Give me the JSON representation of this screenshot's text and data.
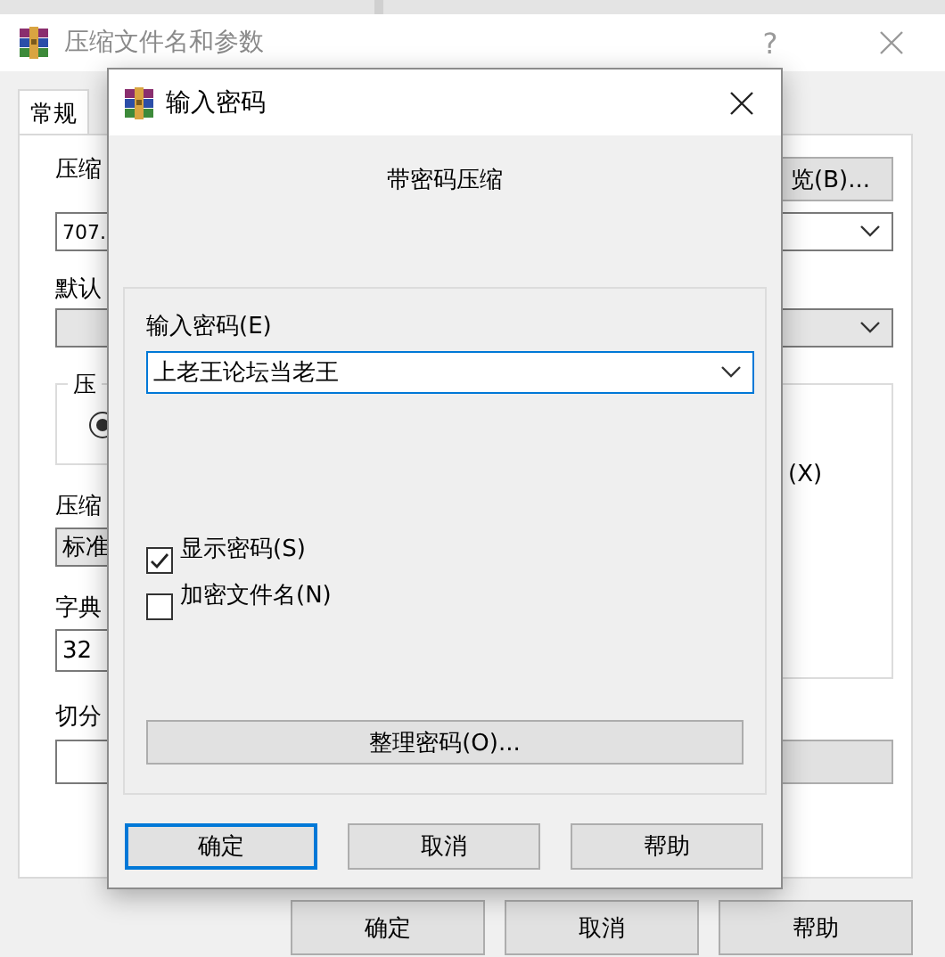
{
  "back_window": {
    "title": "压缩文件名和参数",
    "help_glyph": "?"
  },
  "tabs": [
    {
      "label": "常规",
      "selected": true
    }
  ],
  "general": {
    "archive_label": "压缩",
    "browse_button": "览(B)...",
    "archive_name": "707.",
    "profile_label": "默认",
    "format_label": "压",
    "format_radio_selected": true,
    "method_label": "压缩",
    "method_value": "标准",
    "dict_label": "字典",
    "dict_value": "32",
    "option_fragment": "(X)",
    "split_label": "切分"
  },
  "back_buttons": [
    "确定",
    "取消",
    "帮助"
  ],
  "dialog": {
    "title": "输入密码",
    "heading": "带密码压缩",
    "password_label": "输入密码(E)",
    "password_value": "上老王论坛当老王",
    "checkboxes": [
      {
        "label": "显示密码(S)",
        "checked": true
      },
      {
        "label": "加密文件名(N)",
        "checked": false
      }
    ],
    "manage_button": "整理密码(O)...",
    "buttons": [
      {
        "label": "确定",
        "default": true
      },
      {
        "label": "取消",
        "default": false
      },
      {
        "label": "帮助",
        "default": false
      }
    ]
  }
}
